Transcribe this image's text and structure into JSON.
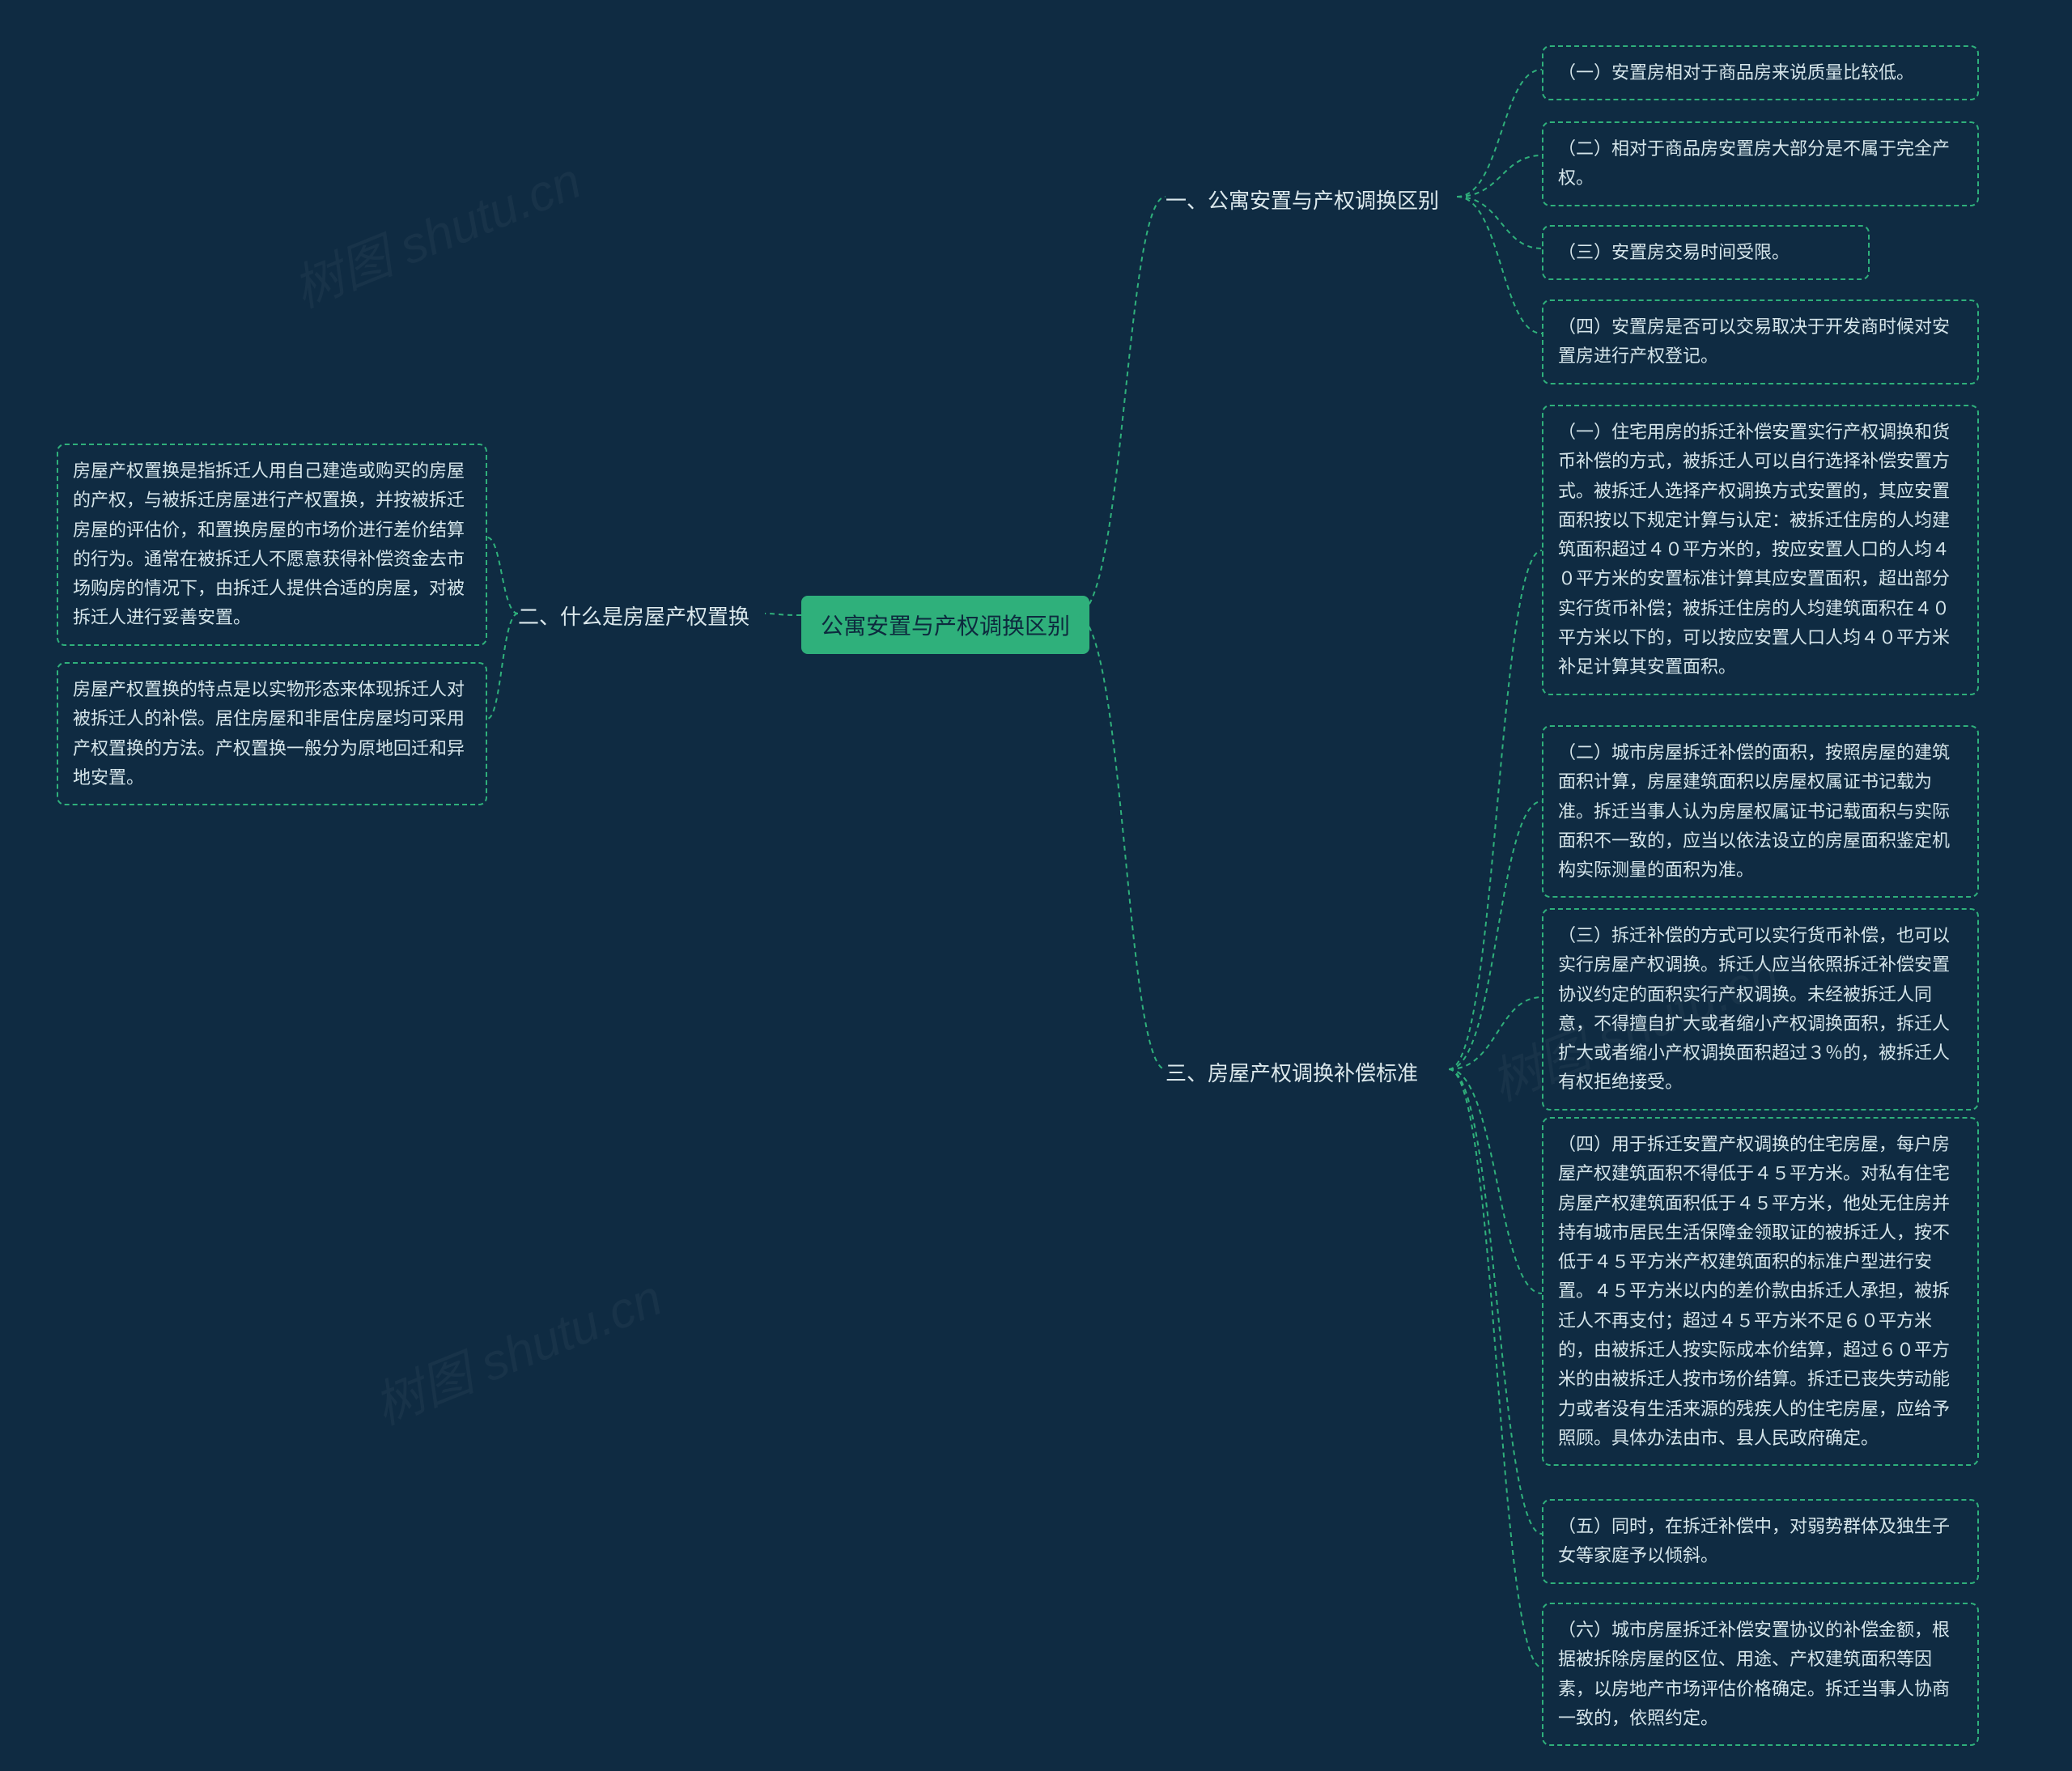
{
  "root": {
    "title": "公寓安置与产权调换区别"
  },
  "branch1": {
    "title": "一、公寓安置与产权调换区别",
    "leaves": [
      "（一）安置房相对于商品房来说质量比较低。",
      "（二）相对于商品房安置房大部分是不属于完全产权。",
      "（三）安置房交易时间受限。",
      "（四）安置房是否可以交易取决于开发商时候对安置房进行产权登记。"
    ]
  },
  "branch2": {
    "title": "二、什么是房屋产权置换",
    "leaves": [
      "房屋产权置换是指拆迁人用自己建造或购买的房屋的产权，与被拆迁房屋进行产权置换，并按被拆迁房屋的评估价，和置换房屋的市场价进行差价结算的行为。通常在被拆迁人不愿意获得补偿资金去市场购房的情况下，由拆迁人提供合适的房屋，对被拆迁人进行妥善安置。",
      "房屋产权置换的特点是以实物形态来体现拆迁人对被拆迁人的补偿。居住房屋和非居住房屋均可采用产权置换的方法。产权置换一般分为原地回迁和异地安置。"
    ]
  },
  "branch3": {
    "title": "三、房屋产权调换补偿标准",
    "leaves": [
      "（一）住宅用房的拆迁补偿安置实行产权调换和货币补偿的方式，被拆迁人可以自行选择补偿安置方式。被拆迁人选择产权调换方式安置的，其应安置面积按以下规定计算与认定：被拆迁住房的人均建筑面积超过４０平方米的，按应安置人口的人均４０平方米的安置标准计算其应安置面积，超出部分实行货币补偿；被拆迁住房的人均建筑面积在４０平方米以下的，可以按应安置人口人均４０平方米补足计算其安置面积。",
      "（二）城市房屋拆迁补偿的面积，按照房屋的建筑面积计算，房屋建筑面积以房屋权属证书记载为准。拆迁当事人认为房屋权属证书记载面积与实际面积不一致的，应当以依法设立的房屋面积鉴定机构实际测量的面积为准。",
      "（三）拆迁补偿的方式可以实行货币补偿，也可以实行房屋产权调换。拆迁人应当依照拆迁补偿安置协议约定的面积实行产权调换。未经被拆迁人同意，不得擅自扩大或者缩小产权调换面积，拆迁人扩大或者缩小产权调换面积超过３％的，被拆迁人有权拒绝接受。",
      "（四）用于拆迁安置产权调换的住宅房屋，每户房屋产权建筑面积不得低于４５平方米。对私有住宅房屋产权建筑面积低于４５平方米，他处无住房并持有城市居民生活保障金领取证的被拆迁人，按不低于４５平方米产权建筑面积的标准户型进行安置。４５平方米以内的差价款由拆迁人承担，被拆迁人不再支付；超过４５平方米不足６０平方米的，由被拆迁人按实际成本价结算，超过６０平方米的由被拆迁人按市场价结算。拆迁已丧失劳动能力或者没有生活来源的残疾人的住宅房屋，应给予照顾。具体办法由市、县人民政府确定。",
      "（五）同时，在拆迁补偿中，对弱势群体及独生子女等家庭予以倾斜。",
      "（六）城市房屋拆迁补偿安置协议的补偿金额，根据被拆除房屋的区位、用途、产权建筑面积等因素，以房地产市场评估价格确定。拆迁当事人协商一致的，依照约定。"
    ]
  },
  "watermarks": [
    "树图 shutu.cn",
    "树图 shutu.cn",
    "树图 shutu.cn"
  ]
}
